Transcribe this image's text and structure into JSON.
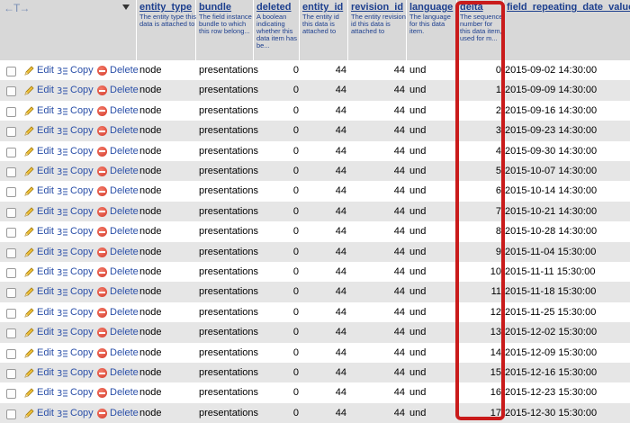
{
  "header": {
    "arrows": "←T→",
    "columns": [
      {
        "key": "entity_type",
        "title": "entity_type",
        "desc": "The entity type this data is attached to"
      },
      {
        "key": "bundle",
        "title": "bundle",
        "desc": "The field instance bundle to which this row belong..."
      },
      {
        "key": "deleted",
        "title": "deleted",
        "desc": "A boolean indicating whether this data item has be..."
      },
      {
        "key": "entity_id",
        "title": "entity_id",
        "desc": "The entity id this data is attached to"
      },
      {
        "key": "revision_id",
        "title": "revision_id",
        "desc": "The entity revision id this data is attached to"
      },
      {
        "key": "language",
        "title": "language",
        "desc": "The language for this data item."
      },
      {
        "key": "delta",
        "title": "delta",
        "desc": "The sequence number for this data item, used for m..."
      },
      {
        "key": "field_repeating_date_value",
        "title": "field_repeating_date_value",
        "desc": ""
      }
    ]
  },
  "actions": {
    "edit": "Edit",
    "copy": "Copy",
    "delete": "Delete"
  },
  "rows": [
    {
      "entity_type": "node",
      "bundle": "presentations",
      "deleted": "0",
      "entity_id": "44",
      "revision_id": "44",
      "language": "und",
      "delta": "0",
      "date": "2015-09-02 14:30:00"
    },
    {
      "entity_type": "node",
      "bundle": "presentations",
      "deleted": "0",
      "entity_id": "44",
      "revision_id": "44",
      "language": "und",
      "delta": "1",
      "date": "2015-09-09 14:30:00"
    },
    {
      "entity_type": "node",
      "bundle": "presentations",
      "deleted": "0",
      "entity_id": "44",
      "revision_id": "44",
      "language": "und",
      "delta": "2",
      "date": "2015-09-16 14:30:00"
    },
    {
      "entity_type": "node",
      "bundle": "presentations",
      "deleted": "0",
      "entity_id": "44",
      "revision_id": "44",
      "language": "und",
      "delta": "3",
      "date": "2015-09-23 14:30:00"
    },
    {
      "entity_type": "node",
      "bundle": "presentations",
      "deleted": "0",
      "entity_id": "44",
      "revision_id": "44",
      "language": "und",
      "delta": "4",
      "date": "2015-09-30 14:30:00"
    },
    {
      "entity_type": "node",
      "bundle": "presentations",
      "deleted": "0",
      "entity_id": "44",
      "revision_id": "44",
      "language": "und",
      "delta": "5",
      "date": "2015-10-07 14:30:00"
    },
    {
      "entity_type": "node",
      "bundle": "presentations",
      "deleted": "0",
      "entity_id": "44",
      "revision_id": "44",
      "language": "und",
      "delta": "6",
      "date": "2015-10-14 14:30:00"
    },
    {
      "entity_type": "node",
      "bundle": "presentations",
      "deleted": "0",
      "entity_id": "44",
      "revision_id": "44",
      "language": "und",
      "delta": "7",
      "date": "2015-10-21 14:30:00"
    },
    {
      "entity_type": "node",
      "bundle": "presentations",
      "deleted": "0",
      "entity_id": "44",
      "revision_id": "44",
      "language": "und",
      "delta": "8",
      "date": "2015-10-28 14:30:00"
    },
    {
      "entity_type": "node",
      "bundle": "presentations",
      "deleted": "0",
      "entity_id": "44",
      "revision_id": "44",
      "language": "und",
      "delta": "9",
      "date": "2015-11-04 15:30:00"
    },
    {
      "entity_type": "node",
      "bundle": "presentations",
      "deleted": "0",
      "entity_id": "44",
      "revision_id": "44",
      "language": "und",
      "delta": "10",
      "date": "2015-11-11 15:30:00"
    },
    {
      "entity_type": "node",
      "bundle": "presentations",
      "deleted": "0",
      "entity_id": "44",
      "revision_id": "44",
      "language": "und",
      "delta": "11",
      "date": "2015-11-18 15:30:00"
    },
    {
      "entity_type": "node",
      "bundle": "presentations",
      "deleted": "0",
      "entity_id": "44",
      "revision_id": "44",
      "language": "und",
      "delta": "12",
      "date": "2015-11-25 15:30:00"
    },
    {
      "entity_type": "node",
      "bundle": "presentations",
      "deleted": "0",
      "entity_id": "44",
      "revision_id": "44",
      "language": "und",
      "delta": "13",
      "date": "2015-12-02 15:30:00"
    },
    {
      "entity_type": "node",
      "bundle": "presentations",
      "deleted": "0",
      "entity_id": "44",
      "revision_id": "44",
      "language": "und",
      "delta": "14",
      "date": "2015-12-09 15:30:00"
    },
    {
      "entity_type": "node",
      "bundle": "presentations",
      "deleted": "0",
      "entity_id": "44",
      "revision_id": "44",
      "language": "und",
      "delta": "15",
      "date": "2015-12-16 15:30:00"
    },
    {
      "entity_type": "node",
      "bundle": "presentations",
      "deleted": "0",
      "entity_id": "44",
      "revision_id": "44",
      "language": "und",
      "delta": "16",
      "date": "2015-12-23 15:30:00"
    },
    {
      "entity_type": "node",
      "bundle": "presentations",
      "deleted": "0",
      "entity_id": "44",
      "revision_id": "44",
      "language": "und",
      "delta": "17",
      "date": "2015-12-30 15:30:00"
    }
  ],
  "colors": {
    "highlight": "#c91b1b",
    "link": "#2a4fa8",
    "header_text": "#1d3f8e",
    "row_alt": "#e6e6e6"
  }
}
